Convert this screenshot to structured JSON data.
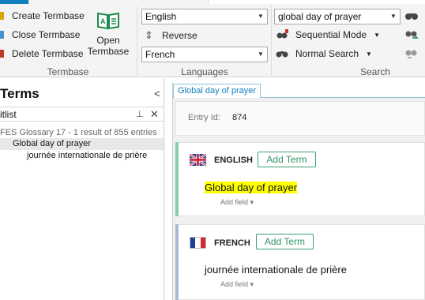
{
  "ribbon": {
    "termbase_group": {
      "create": "Create Termbase",
      "close": "Close Termbase",
      "delete": "Delete Termbase",
      "open_line1": "Open",
      "open_line2": "Termbase",
      "label": "Termbase"
    },
    "languages_group": {
      "source_language": "English",
      "reverse": "Reverse",
      "target_language": "French",
      "label": "Languages"
    },
    "search_group": {
      "search_value": "global day of prayer",
      "sequential_mode": "Sequential Mode",
      "normal_search": "Normal Search",
      "label": "Search"
    }
  },
  "terms_panel": {
    "title": "Terms",
    "hitlist_label": "itlist",
    "summary": "FES Glossary 17 - 1 result of 855 entries",
    "source_hit": "Global day of prayer",
    "target_hit": "journée internationale de prière"
  },
  "entry": {
    "tab_label": "Global day of prayer",
    "entry_id_label": "Entry Id:",
    "entry_id_value": "874",
    "languages": [
      {
        "name": "ENGLISH",
        "add_term": "Add Term",
        "term": "Global day of prayer",
        "add_field": "Add field ▾"
      },
      {
        "name": "FRENCH",
        "add_term": "Add Term",
        "term": "journée internationale de prière",
        "add_field": "Add field ▾"
      }
    ]
  },
  "colors": {
    "accent_blue": "#0f7fc0",
    "add_term_green": "#2f9466",
    "english_bar": "#86cfa9",
    "french_bar": "#aab8d8",
    "highlight": "#ffff00"
  }
}
